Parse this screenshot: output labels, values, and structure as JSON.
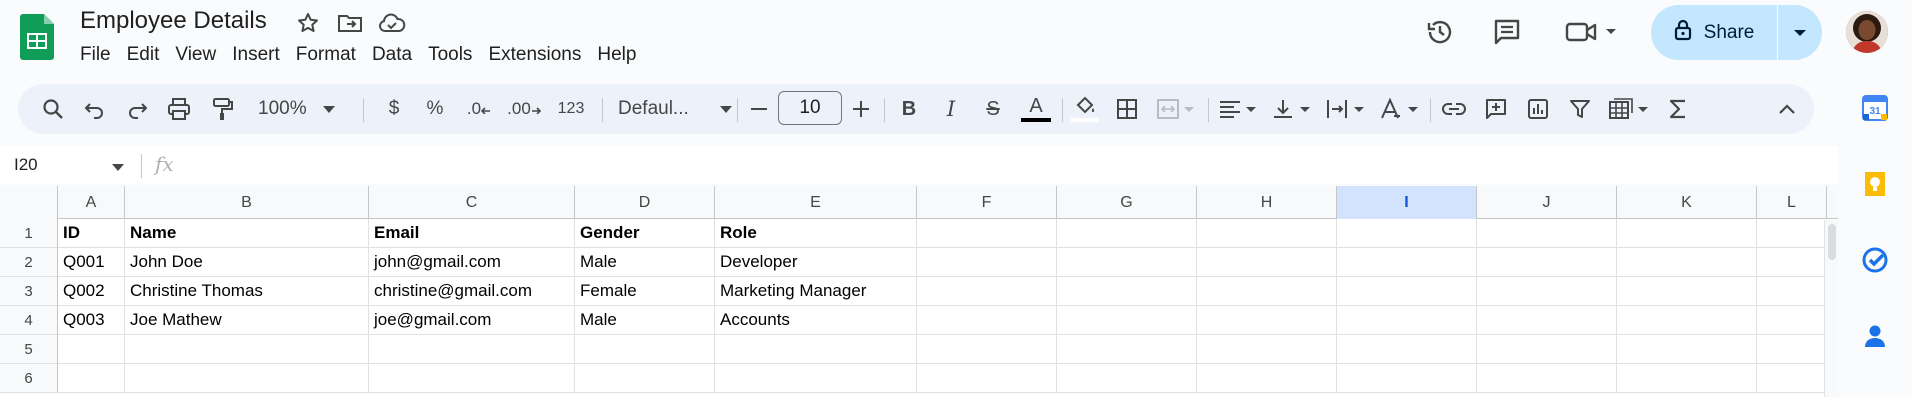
{
  "document": {
    "title": "Employee Details"
  },
  "menu": [
    "File",
    "Edit",
    "View",
    "Insert",
    "Format",
    "Data",
    "Tools",
    "Extensions",
    "Help"
  ],
  "share": {
    "label": "Share"
  },
  "toolbar": {
    "zoom": "100%",
    "currency": "$",
    "percent": "%",
    "dec_decrease": ".0",
    "dec_increase": ".00",
    "more_formats": "123",
    "font": "Defaul...",
    "font_size": "10",
    "bold": "B",
    "italic": "I",
    "strike": "S",
    "text_color": "A"
  },
  "formula_bar": {
    "cell_ref": "I20",
    "fx": "fx",
    "value": ""
  },
  "grid": {
    "columns": [
      "A",
      "B",
      "C",
      "D",
      "E",
      "F",
      "G",
      "H",
      "I",
      "J",
      "K",
      "L"
    ],
    "selected_column": "I",
    "row_numbers": [
      "1",
      "2",
      "3",
      "4",
      "5",
      "6"
    ],
    "rows": [
      [
        "ID",
        "Name",
        "Email",
        "Gender",
        "Role"
      ],
      [
        "Q001",
        "John Doe",
        "john@gmail.com",
        "Male",
        "Developer"
      ],
      [
        "Q002",
        "Christine Thomas",
        "christine@gmail.com",
        "Female",
        "Marketing Manager"
      ],
      [
        "Q003",
        "Joe Mathew",
        "joe@gmail.com",
        "Male",
        "Accounts"
      ],
      [
        "",
        "",
        "",
        "",
        ""
      ],
      [
        "",
        "",
        "",
        "",
        ""
      ]
    ]
  },
  "colors": {
    "brand_green": "#0f9d58",
    "share_bg": "#c2e7ff",
    "toolbar_bg": "#edf2fa",
    "selection": "#d3e3fd"
  },
  "side_panel": [
    "calendar-icon",
    "keep-icon",
    "tasks-icon",
    "contacts-icon"
  ]
}
